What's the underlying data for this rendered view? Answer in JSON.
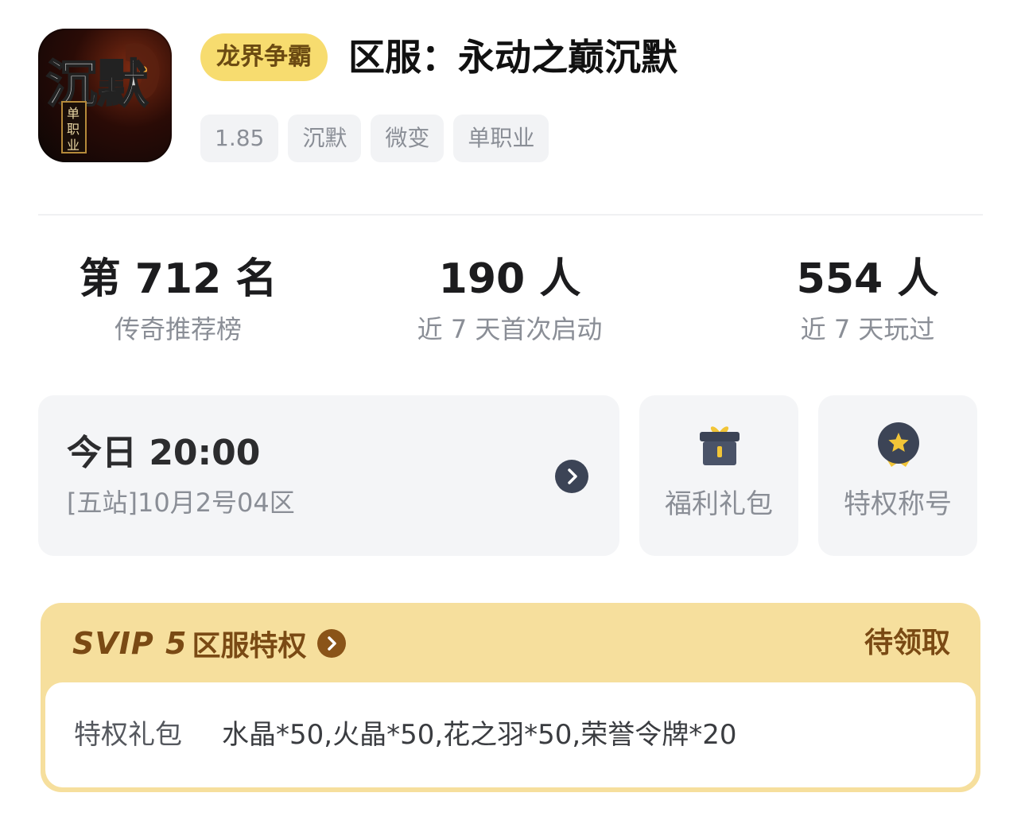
{
  "game": {
    "icon_name": "game-logo-icon",
    "icon_text_main": "沉默",
    "icon_text_sub": "单职业",
    "badge": "龙界争霸",
    "server_title": "区服：永动之巅沉默",
    "tags": [
      "1.85",
      "沉默",
      "微变",
      "单职业"
    ]
  },
  "stats": [
    {
      "value": "第 712 名",
      "label": "传奇推荐榜"
    },
    {
      "value": "190 人",
      "label": "近 7 天首次启动"
    },
    {
      "value": "554 人",
      "label": "近 7 天玩过"
    }
  ],
  "open_card": {
    "time": "今日  20:00",
    "server": "[五站]10月2号04区",
    "arrow_icon": "chevron-right-icon"
  },
  "quick_actions": [
    {
      "label": "福利礼包",
      "icon": "gift-box-icon"
    },
    {
      "label": "特权称号",
      "icon": "star-medal-icon"
    }
  ],
  "svip": {
    "level": "SVIP 5",
    "title": "区服特权",
    "status": "待领取",
    "privilege_label": "特权礼包",
    "privilege_value": "水晶*50,火晶*50,花之羽*50,荣誉令牌*20"
  },
  "colors": {
    "badge_bg": "#f7dc6f",
    "svip_bg": "#f6df9d",
    "svip_text": "#7a4a14",
    "card_bg": "#f4f5f7",
    "muted_text": "#8a8e96"
  }
}
